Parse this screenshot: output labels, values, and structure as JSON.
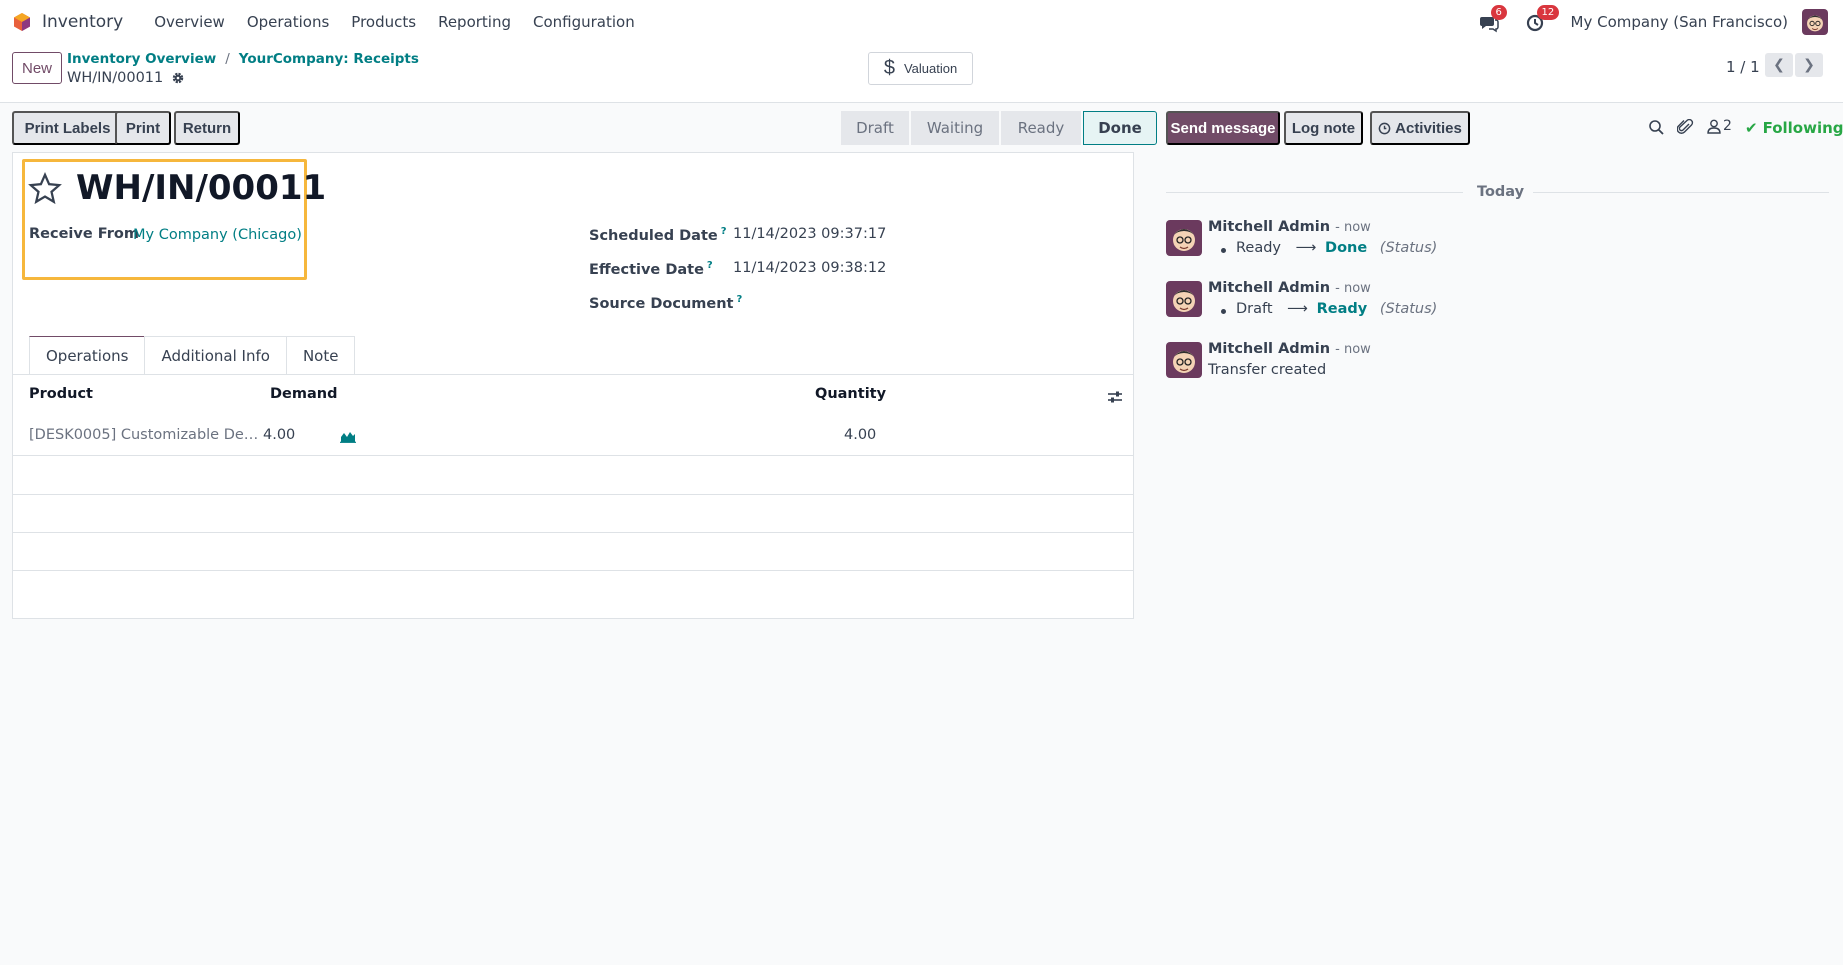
{
  "app": {
    "name": "Inventory",
    "brand_color": "#714b67",
    "accent_color": "#017e84"
  },
  "menu": [
    {
      "label": "Overview"
    },
    {
      "label": "Operations"
    },
    {
      "label": "Products"
    },
    {
      "label": "Reporting"
    },
    {
      "label": "Configuration"
    }
  ],
  "systray": {
    "messages_icon": "chat-icon",
    "messages_count": "6",
    "activities_icon": "clock-icon",
    "activities_count": "12",
    "company": "My Company (San Francisco)"
  },
  "control_panel": {
    "new_label": "New",
    "breadcrumbs": [
      {
        "label": "Inventory Overview"
      },
      {
        "label": "YourCompany: Receipts"
      }
    ],
    "breadcrumb_sep": "/",
    "record": "WH/IN/00011",
    "valuation_label": "Valuation",
    "pager": "1 / 1"
  },
  "actions": {
    "print_labels": "Print Labels",
    "print": "Print",
    "return": "Return"
  },
  "statusbar": {
    "stages": [
      {
        "label": "Draft"
      },
      {
        "label": "Waiting"
      },
      {
        "label": "Ready"
      },
      {
        "label": "Done"
      }
    ],
    "current": "Done"
  },
  "form": {
    "title": "WH/IN/00011",
    "receive_from_label": "Receive From",
    "receive_from_value": "My Company (Chicago)",
    "scheduled_date_label": "Scheduled Date",
    "scheduled_date_value": "11/14/2023 09:37:17",
    "effective_date_label": "Effective Date",
    "effective_date_value": "11/14/2023 09:38:12",
    "source_document_label": "Source Document",
    "help_mark": "?"
  },
  "tabs": [
    {
      "label": "Operations"
    },
    {
      "label": "Additional Info"
    },
    {
      "label": "Note"
    }
  ],
  "operations_table": {
    "columns": {
      "product": "Product",
      "demand": "Demand",
      "quantity": "Quantity"
    },
    "rows": [
      {
        "product": "[DESK0005] Customizable De…",
        "demand": "4.00",
        "quantity": "4.00"
      }
    ]
  },
  "chatter": {
    "send_message": "Send message",
    "log_note": "Log note",
    "activities": "Activities",
    "followers_count": "2",
    "following": "Following",
    "date_separator": "Today",
    "messages": [
      {
        "author": "Mitchell Admin",
        "time": "- now",
        "old": "Ready",
        "new": "Done",
        "field": "(Status)"
      },
      {
        "author": "Mitchell Admin",
        "time": "- now",
        "old": "Draft",
        "new": "Ready",
        "field": "(Status)"
      },
      {
        "author": "Mitchell Admin",
        "time": "- now",
        "body": "Transfer created"
      }
    ]
  }
}
